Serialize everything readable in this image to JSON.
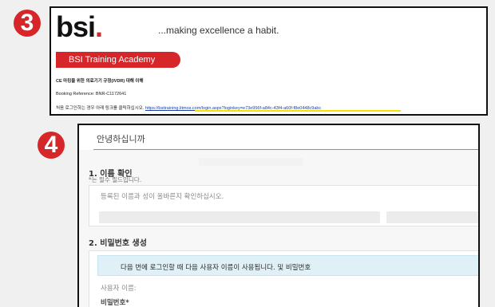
{
  "badges": {
    "step3": "3",
    "step4": "4"
  },
  "email": {
    "logo_text": "bsi",
    "logo_dot": ".",
    "tagline": "...making excellence a habit.",
    "academy_label": "BSI Training Academy",
    "line1": "CE 마킹을 위한 의료기기 규정(IVDR) 대해 이해",
    "line2": "Booking Reference: BNR-C1172641",
    "line3_prefix": "처음 로그인하는 경우 아래 링크를 클릭하십시오.",
    "link_text": "https://bsitraining.litmos.com/login.aspx?loginkey=e73e956f-a84c-43f4-a60f-f8e0448c9abc"
  },
  "form": {
    "greeting": "안녕하십니까",
    "section1_title": "1. 이름 확인",
    "required_note": "*는 필수 필드입니다.",
    "name_hint": "등록된 이름과 성이 올바른지 확인하십시오.",
    "section2_title": "2. 비밀번호 생성",
    "info_text": "다음 번에 로그인할 때 다음 사용자 이름이 사용됩니다. 및 비밀번호",
    "username_label": "사용자 이름:",
    "password_label": "비밀번호",
    "password_required": "*"
  },
  "colors": {
    "brand_red": "#d7262a",
    "info_blue": "#dff0f7",
    "link_highlight": "#f4e200"
  }
}
